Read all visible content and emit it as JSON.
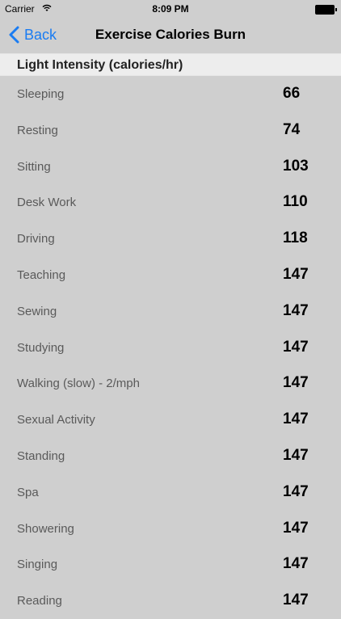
{
  "status_bar": {
    "carrier": "Carrier",
    "time": "8:09 PM"
  },
  "nav": {
    "back_label": "Back",
    "title": "Exercise Calories Burn"
  },
  "section": {
    "title": "Light Intensity (calories/hr)"
  },
  "rows": [
    {
      "name": "Sleeping",
      "value": "66"
    },
    {
      "name": "Resting",
      "value": "74"
    },
    {
      "name": "Sitting",
      "value": "103"
    },
    {
      "name": "Desk Work",
      "value": "110"
    },
    {
      "name": "Driving",
      "value": "118"
    },
    {
      "name": "Teaching",
      "value": "147"
    },
    {
      "name": "Sewing",
      "value": "147"
    },
    {
      "name": "Studying",
      "value": "147"
    },
    {
      "name": "Walking (slow) - 2/mph",
      "value": "147"
    },
    {
      "name": "Sexual Activity",
      "value": "147"
    },
    {
      "name": "Standing",
      "value": "147"
    },
    {
      "name": "Spa",
      "value": "147"
    },
    {
      "name": "Showering",
      "value": "147"
    },
    {
      "name": "Singing",
      "value": "147"
    },
    {
      "name": "Reading",
      "value": "147"
    }
  ],
  "colors": {
    "accent": "#1a7cf2",
    "background": "#cfcfcf",
    "header_bg": "#ededed"
  },
  "icons": {
    "wifi": "wifi-icon",
    "battery": "battery-icon",
    "back": "chevron-left-icon"
  }
}
